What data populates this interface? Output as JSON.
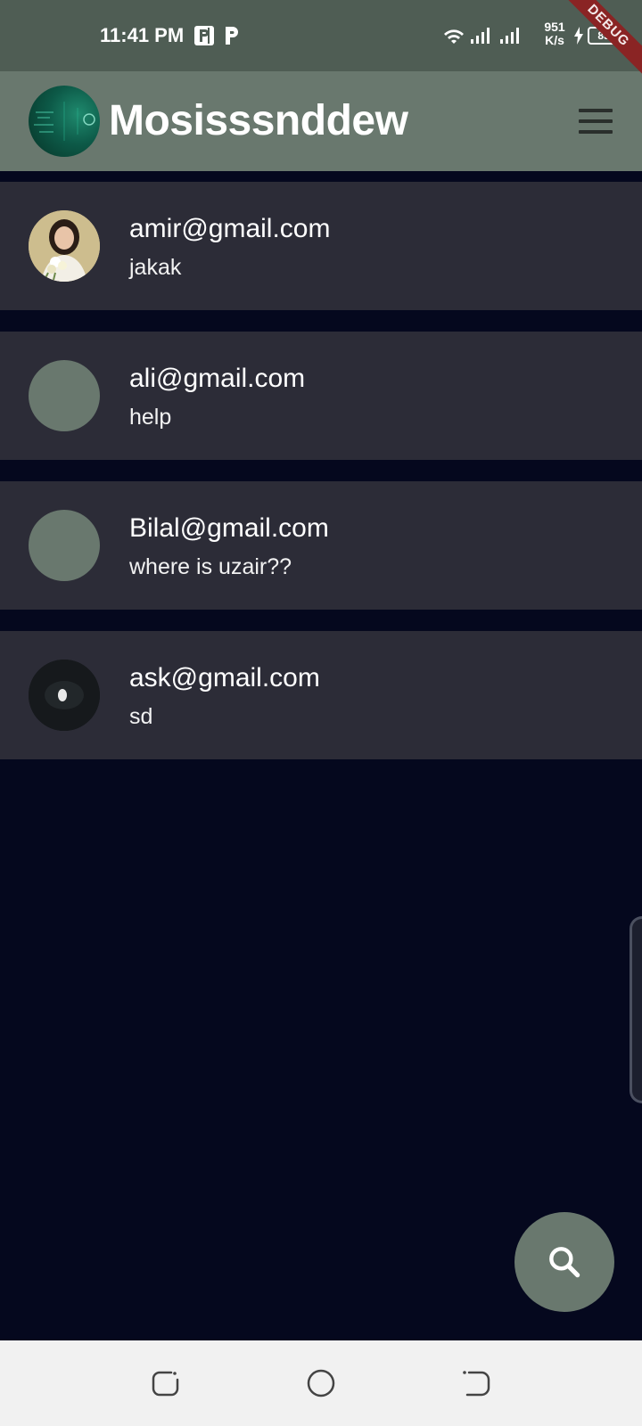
{
  "status_bar": {
    "time": "11:41 PM",
    "net_speed_value": "951",
    "net_speed_unit": "K/s",
    "battery": "85",
    "debug_label": "DEBUG"
  },
  "app_bar": {
    "title": "Mosisssnddew"
  },
  "chats": [
    {
      "email": "amir@gmail.com",
      "message": "jakak"
    },
    {
      "email": "ali@gmail.com",
      "message": "help"
    },
    {
      "email": "Bilal@gmail.com",
      "message": "where is uzair??"
    },
    {
      "email": "ask@gmail.com",
      "message": "sd"
    }
  ],
  "icons": {
    "menu": "hamburger-menu-icon",
    "fab": "search-icon",
    "nav": [
      "recent-apps-icon",
      "home-icon",
      "back-icon"
    ]
  },
  "colors": {
    "app_bar": "#69786e",
    "status_bar": "#4f5d54",
    "background": "#05081e",
    "chat_item": "#2c2c37",
    "fab": "#69786e",
    "nav_bar": "#f1f1f1"
  }
}
